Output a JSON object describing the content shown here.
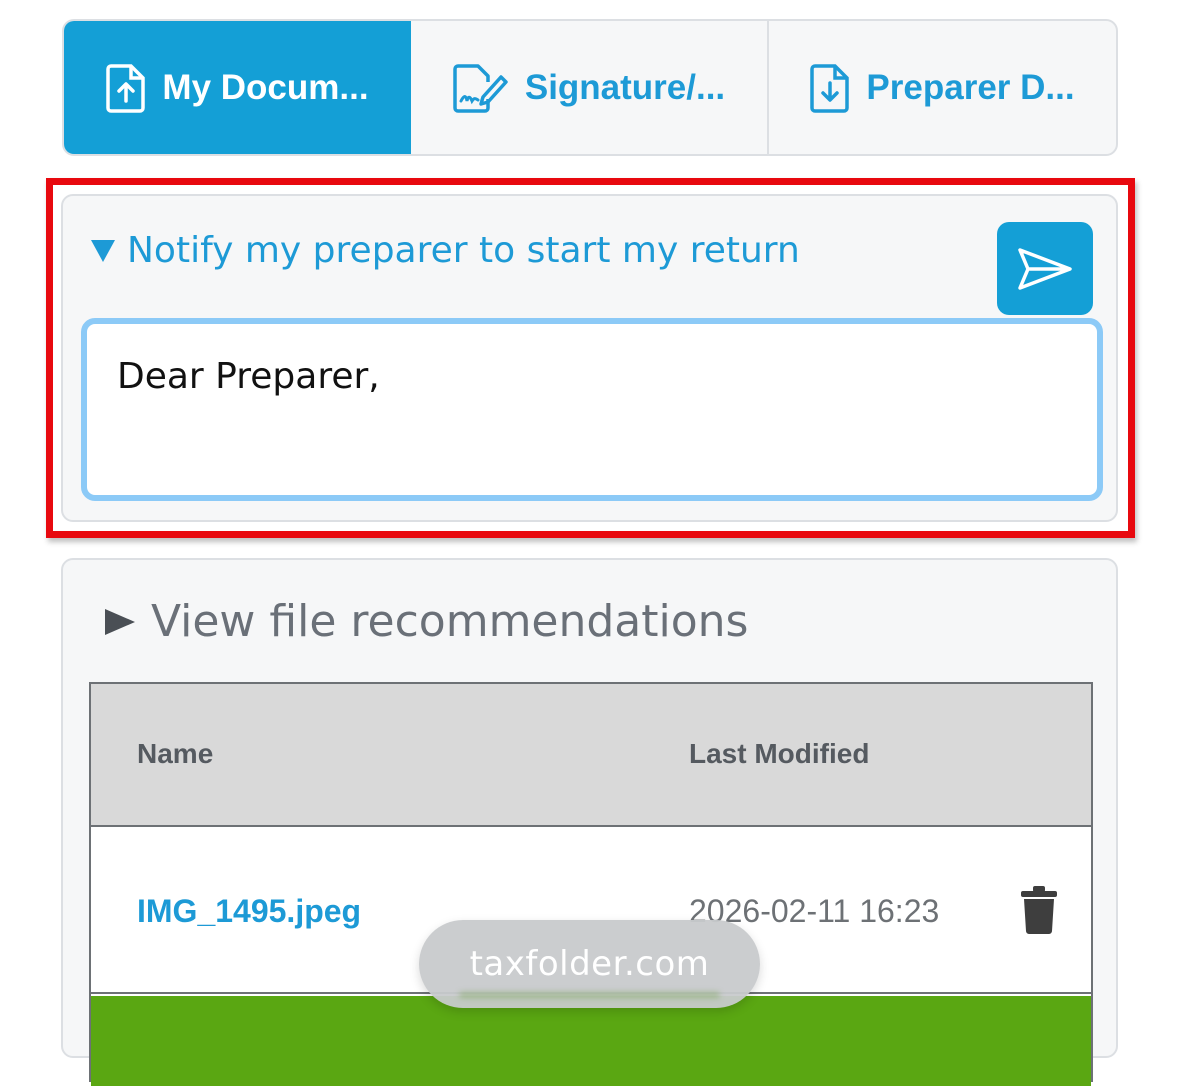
{
  "tabs": [
    {
      "label": "My Docum...",
      "icon": "upload-document-icon",
      "active": true
    },
    {
      "label": "Signature/...",
      "icon": "sign-document-icon",
      "active": false
    },
    {
      "label": "Preparer D...",
      "icon": "download-document-icon",
      "active": false
    }
  ],
  "notify": {
    "title": "Notify my preparer to start my return",
    "message": "Dear Preparer,",
    "send_icon": "send-icon"
  },
  "files": {
    "recommendations_label": "View file recommendations",
    "columns": {
      "name": "Name",
      "last_modified": "Last Modified"
    },
    "rows": [
      {
        "name": "IMG_1495.jpeg",
        "last_modified": "2026-02-11 16:23"
      }
    ]
  },
  "browser": {
    "url": "taxfolder.com"
  },
  "colors": {
    "accent": "#149fd6",
    "highlight": "#e8090f",
    "input_focus": "#8ccaf7",
    "success_bar": "#5aa712"
  }
}
